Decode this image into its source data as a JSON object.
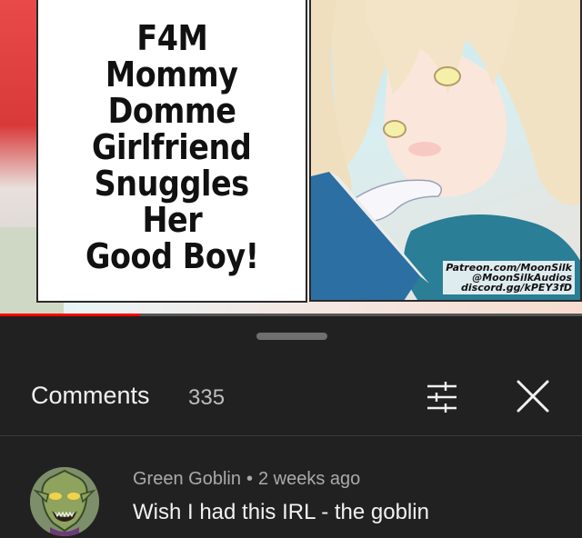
{
  "video": {
    "title_lines": [
      "F4M",
      "Mommy",
      "Domme",
      "Girlfriend",
      "Snuggles",
      "Her",
      "Good Boy!"
    ],
    "credits": [
      "Patreon.com/MoonSilk",
      "@MoonSilkAudios",
      "discord.gg/kPEY3fD"
    ],
    "progress_fraction": 0.24
  },
  "comments_panel": {
    "title": "Comments",
    "count": "335",
    "filter_icon": "sort-filter-icon",
    "close_icon": "close-icon"
  },
  "comment": {
    "author": "Green Goblin",
    "separator": "•",
    "time": "2 weeks ago",
    "text": "Wish I had this IRL - the goblin",
    "avatar_icon": "goblin-avatar"
  },
  "colors": {
    "background": "#212121",
    "primary_text": "#f1f1f1",
    "secondary_text": "#aaaaaa",
    "progress": "#ff0000"
  }
}
